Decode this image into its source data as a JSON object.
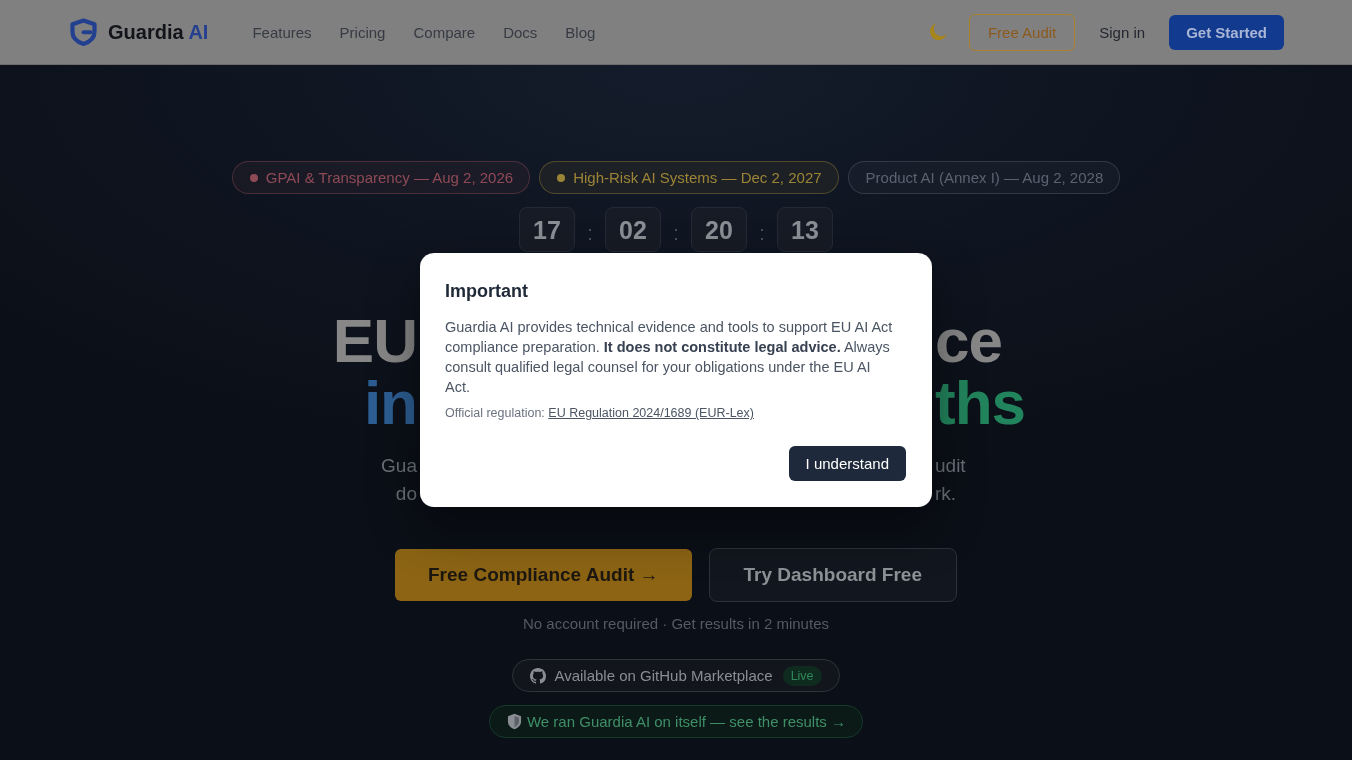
{
  "header": {
    "logo": {
      "name": "Guardia",
      "accent": "AI"
    },
    "nav": [
      "Features",
      "Pricing",
      "Compare",
      "Docs",
      "Blog"
    ],
    "buttons": [
      {
        "label": "Free Audit",
        "kind": "outline"
      },
      {
        "label": "Sign in",
        "kind": "plain"
      },
      {
        "label": "Get Started",
        "kind": "primary"
      }
    ]
  },
  "hero": {
    "deadlines": [
      {
        "label": "GPAI & Transparency — Aug 2, 2026",
        "color": "#8f4a56",
        "dot": true
      },
      {
        "label": "High-Risk AI Systems — Dec 2, 2027",
        "color": "#9c8436",
        "dot": true
      },
      {
        "label": "Product AI (Annex I) — Aug 2, 2028",
        "color": "#5c6270",
        "dot": false
      }
    ],
    "countdown": {
      "values": [
        "17",
        "02",
        "20",
        "13"
      ],
      "separators": [
        ":",
        ":",
        ":"
      ]
    },
    "title_lines": [
      {
        "left": "EU",
        "right": "ce"
      },
      {
        "left": "in",
        "right": "ths"
      }
    ],
    "subtitle_lines": [
      {
        "left": "Gua",
        "right": "udit"
      },
      {
        "left": "do",
        "right": "rk."
      }
    ],
    "actions": [
      {
        "label": "Free Compliance Audit →",
        "kind": "primary"
      },
      {
        "label": "Try Dashboard Free",
        "kind": "secondary"
      }
    ],
    "note": "No account required · Get results in 2 minutes",
    "badges": [
      {
        "kind": "github",
        "label": "Available on GitHub Marketplace",
        "tag": "Live"
      },
      {
        "kind": "shield",
        "label": "We ran Guardia AI on itself — see the results →"
      }
    ]
  },
  "modal": {
    "title": "Important",
    "body": "Guardia AI provides technical evidence and tools to support EU AI Act compliance preparation. **It does not constitute legal advice.** Always consult qualified legal counsel for your obligations under the EU AI Act.",
    "source_label": "Official regulation:",
    "source_link": "EU Regulation 2024/1689 (EUR-Lex)",
    "button": "I understand"
  }
}
